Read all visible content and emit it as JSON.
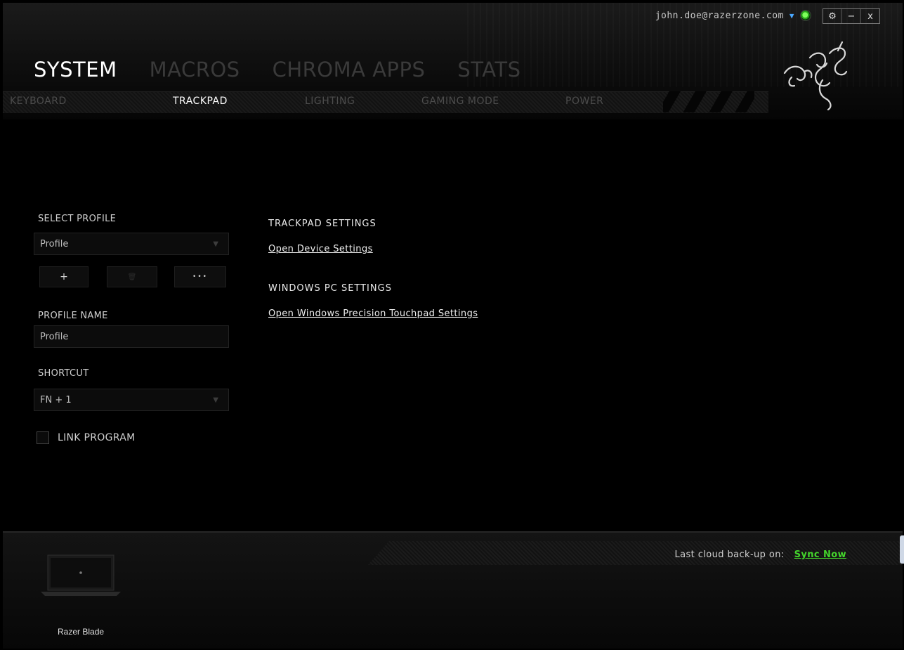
{
  "header": {
    "account_email": "john.doe@razerzone.com",
    "main_tabs": [
      "SYSTEM",
      "MACROS",
      "CHROMA APPS",
      "STATS"
    ],
    "active_main_tab": "SYSTEM",
    "sub_tabs": [
      "KEYBOARD",
      "TRACKPAD",
      "LIGHTING",
      "GAMING MODE",
      "POWER"
    ],
    "active_sub_tab": "TRACKPAD",
    "window_controls": [
      "⚙",
      "−",
      "x"
    ]
  },
  "profile_panel": {
    "select_profile_label": "SELECT PROFILE",
    "selected_profile": "Profile",
    "add_label": "+",
    "delete_label": "🗑",
    "more_label": "•••",
    "profile_name_label": "PROFILE NAME",
    "profile_name_value": "Profile",
    "shortcut_label": "SHORTCUT",
    "shortcut_value": "FN + 1",
    "link_program_label": "LINK PROGRAM",
    "dropdown_glyph": "▼"
  },
  "content": {
    "trackpad_settings_title": "TRACKPAD SETTINGS",
    "open_device_settings": "Open Device Settings",
    "windows_pc_settings_title": "WINDOWS PC SETTINGS",
    "open_windows_precision": "Open Windows Precision Touchpad Settings"
  },
  "footer": {
    "last_backup_label": "Last cloud back-up on:",
    "sync_now": "Sync Now",
    "device_name": "Razer Blade"
  },
  "colors": {
    "accent_green": "#44d62c",
    "background": "#000000"
  }
}
